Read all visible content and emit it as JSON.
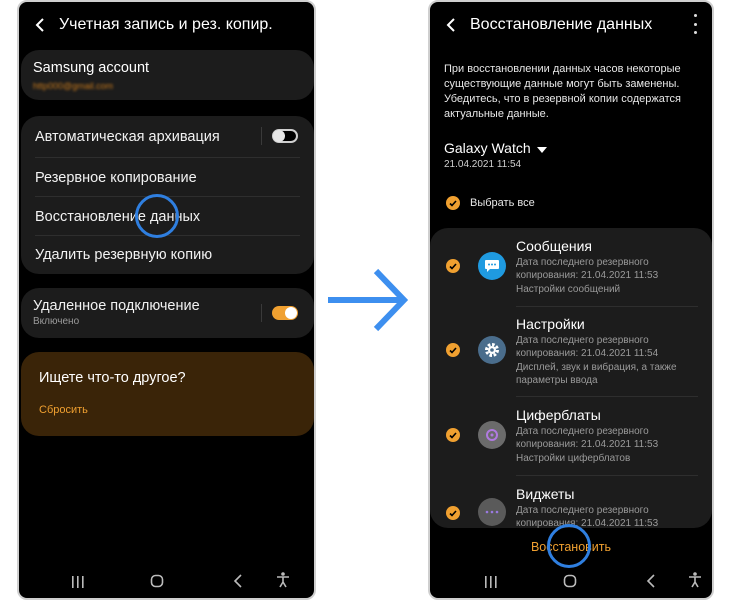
{
  "left": {
    "title": "Учетная запись и рез. копир.",
    "account": {
      "name": "Samsung account",
      "email": "http000@gmail.com"
    },
    "backup_items": [
      {
        "label": "Автоматическая архивация",
        "toggle": false
      },
      {
        "label": "Резервное копирование"
      },
      {
        "label": "Восстановление данных"
      },
      {
        "label": "Удалить резервную копию"
      }
    ],
    "remote": {
      "label": "Удаленное подключение",
      "status": "Включено",
      "toggle": true
    },
    "suggest": {
      "title": "Ищете что-то другое?",
      "link": "Сбросить"
    }
  },
  "right": {
    "title": "Восстановление данных",
    "description": "При восстановлении данных часов некоторые существующие данные могут быть заменены. Убедитесь, что в резервной копии содержатся актуальные данные.",
    "device": {
      "name": "Galaxy Watch",
      "date": "21.04.2021 11:54"
    },
    "select_all": "Выбрать все",
    "items": [
      {
        "title": "Сообщения",
        "date_line": "Дата последнего резервного копирования: 21.04.2021 11:53",
        "detail": "Настройки сообщений",
        "icon": "messages-icon"
      },
      {
        "title": "Настройки",
        "date_line": "Дата последнего резервного копирования: 21.04.2021 11:54",
        "detail": "Дисплей, звук и вибрация, а также параметры ввода",
        "icon": "gear-icon"
      },
      {
        "title": "Циферблаты",
        "date_line": "Дата последнего резервного копирования: 21.04.2021 11:53",
        "detail": "Настройки циферблатов",
        "icon": "watchface-icon"
      },
      {
        "title": "Виджеты",
        "date_line": "Дата последнего резервного копирования: 21.04.2021 11:53",
        "detail": "",
        "icon": "widgets-icon"
      }
    ],
    "restore_button": "Восстановить"
  },
  "colors": {
    "accent": "#f0a030",
    "highlight": "#2f7fe0",
    "arrow": "#3d8fef",
    "card": "#1c1c1c",
    "suggest_bg": "#3a2408"
  }
}
